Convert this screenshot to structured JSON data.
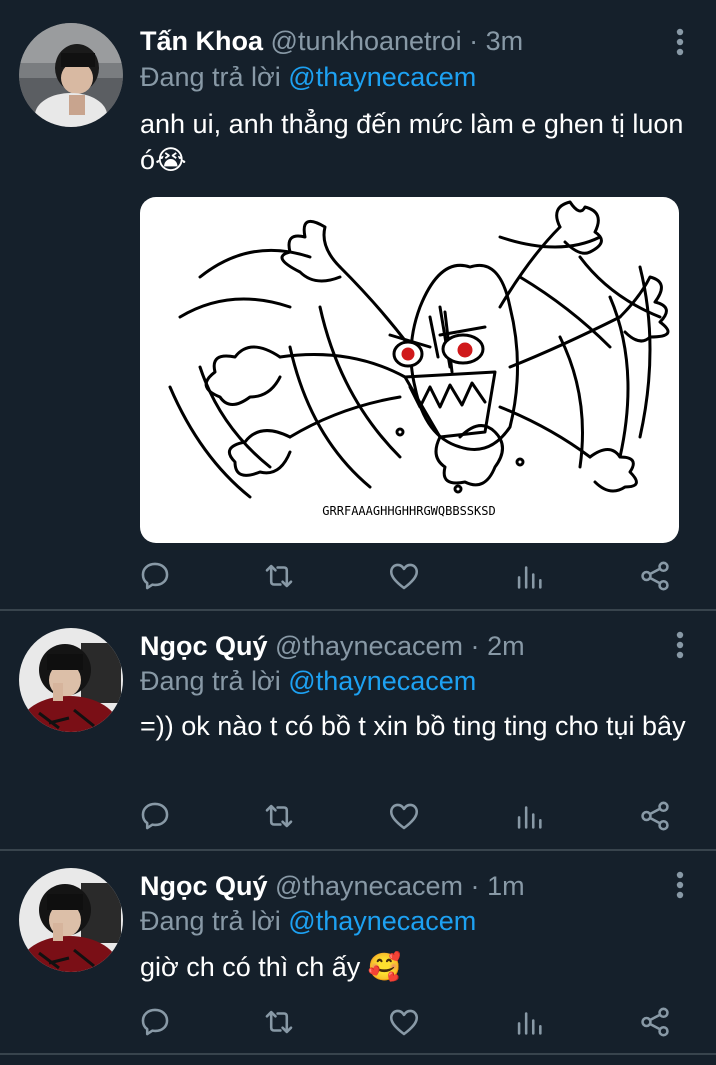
{
  "colors": {
    "background": "#15202b",
    "divider": "#38444d",
    "secondary_text": "#8899a6",
    "mention": "#1da1f2"
  },
  "tweets": [
    {
      "name": "Tấn Khoa",
      "handle": "@tunkhoanetroi",
      "dot": "·",
      "time": "3m",
      "reply_prefix": "Đang trả lời",
      "reply_to": "@thaynecacem",
      "text": "anh ui, anh thẳng đến mức làm e ghen tị luon ó😭",
      "media_caption": "GRRFAAAGHHGHHRGWQBBSSKSD"
    },
    {
      "name": "Ngọc Quý",
      "handle": "@thaynecacem",
      "dot": "·",
      "time": "2m",
      "reply_prefix": "Đang trả lời",
      "reply_to": "@thaynecacem",
      "text": "=)) ok nào t có bồ t xin bồ ting ting cho tụi bây"
    },
    {
      "name": "Ngọc Quý",
      "handle": "@thaynecacem",
      "dot": "·",
      "time": "1m",
      "reply_prefix": "Đang trả lời",
      "reply_to": "@thaynecacem",
      "text": "giờ ch có thì ch ấy 🥰"
    }
  ],
  "action_icons": [
    "reply-icon",
    "retweet-icon",
    "like-icon",
    "analytics-icon",
    "share-icon"
  ]
}
